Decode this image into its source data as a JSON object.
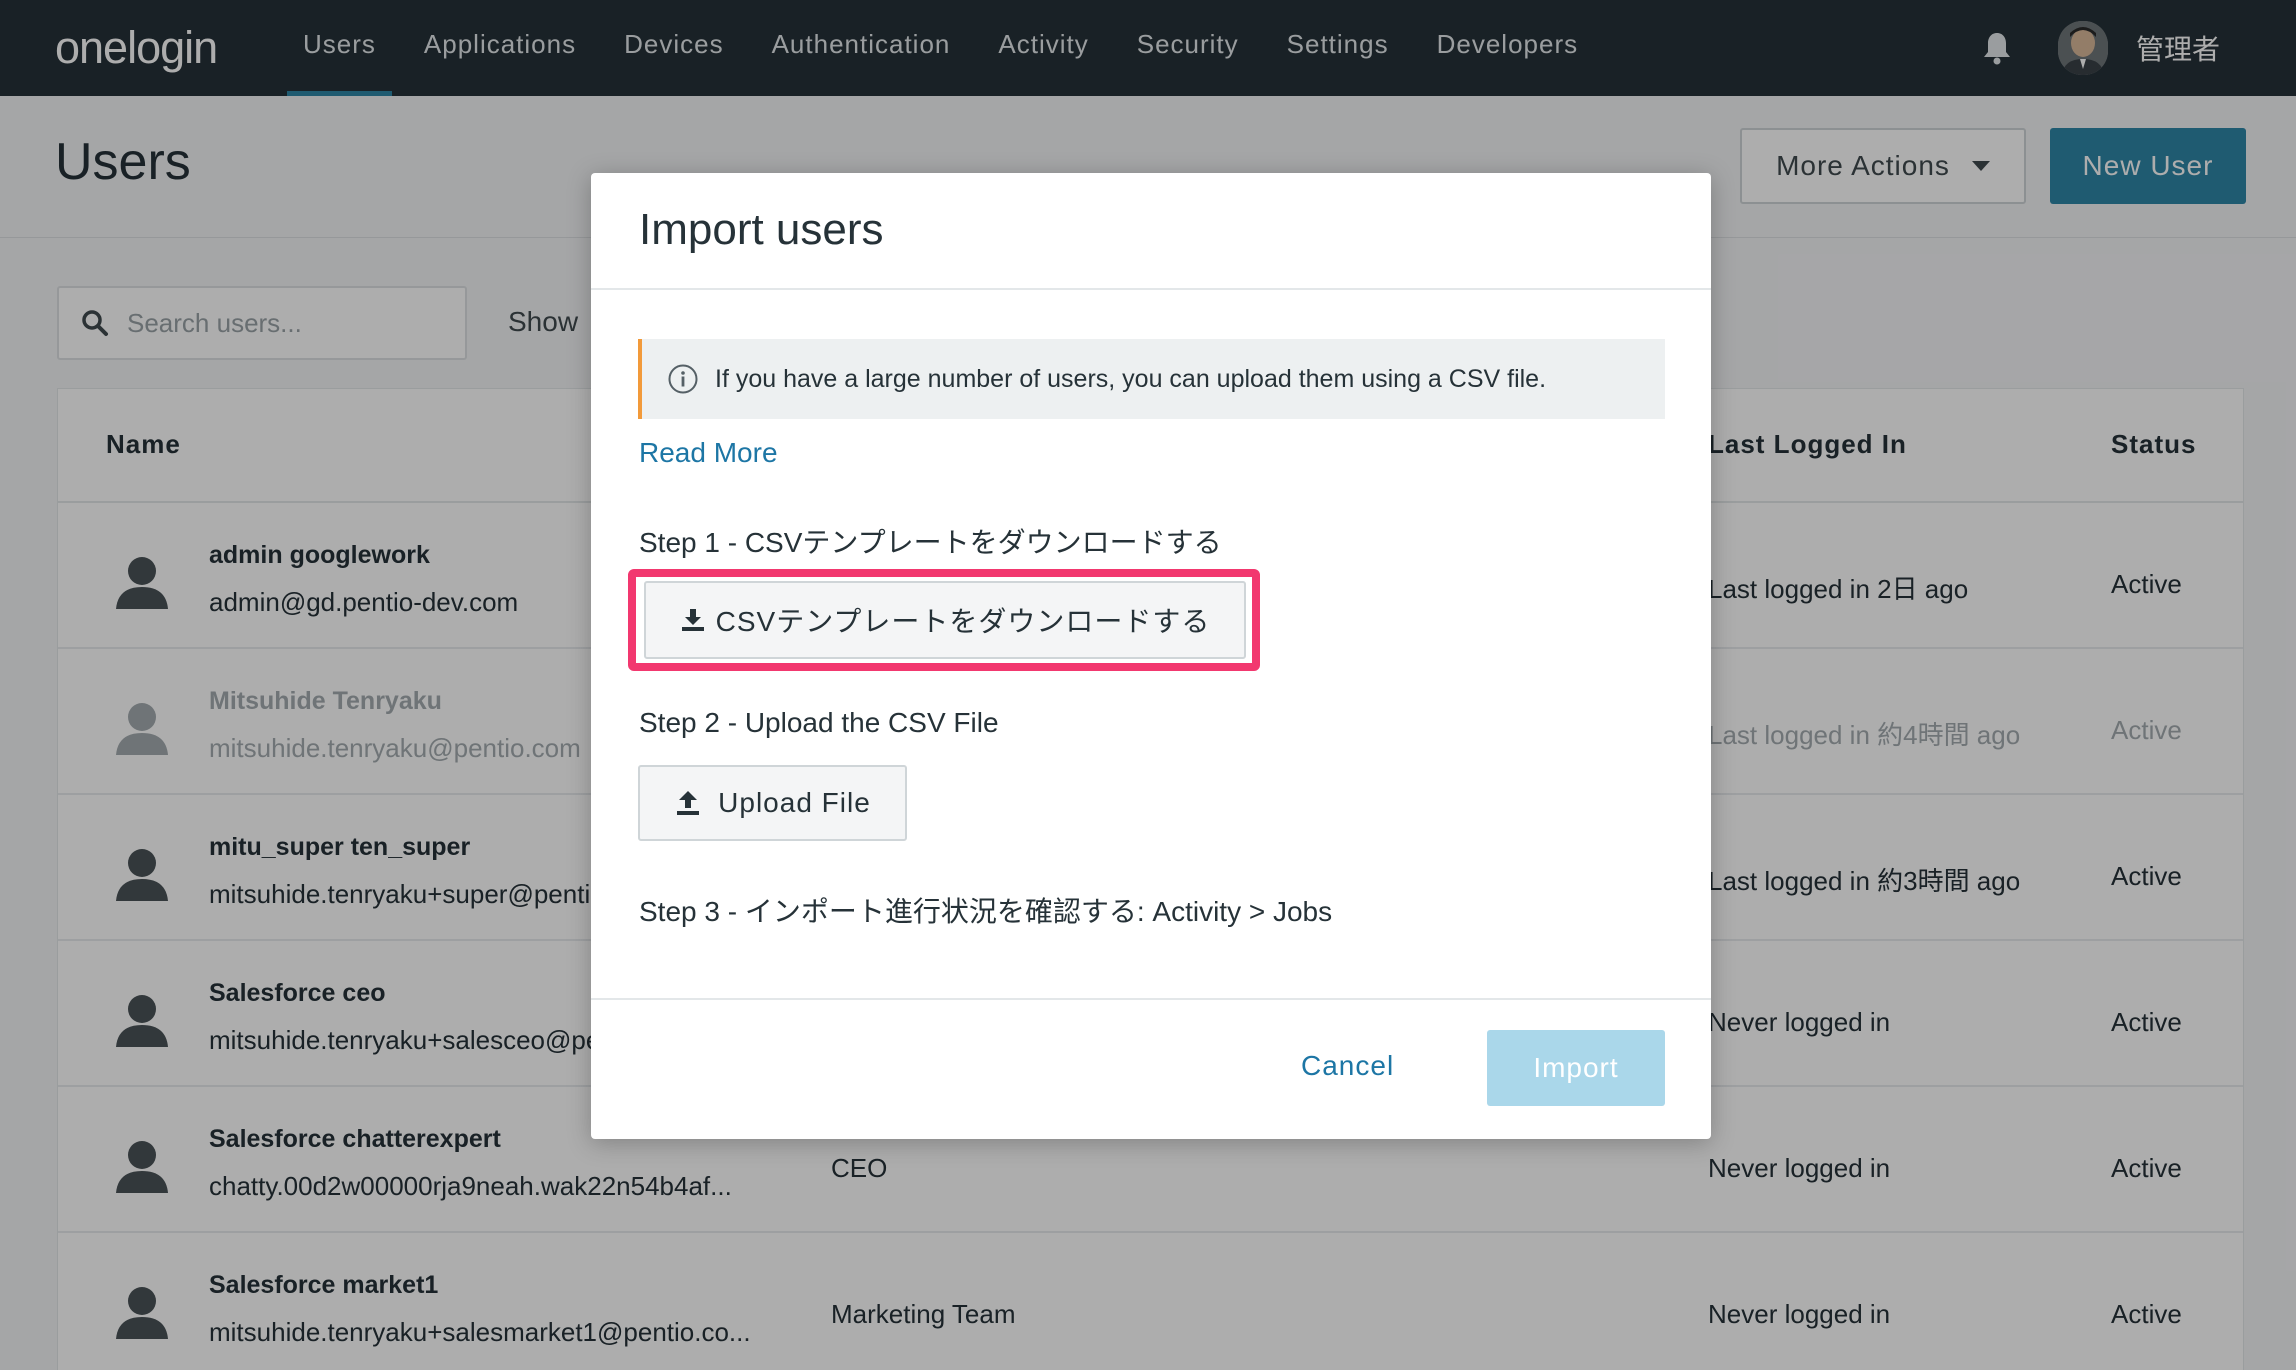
{
  "nav": {
    "logo": "onelogin",
    "items": [
      "Users",
      "Applications",
      "Devices",
      "Authentication",
      "Activity",
      "Security",
      "Settings",
      "Developers"
    ],
    "active_index": 0,
    "admin_name": "管理者"
  },
  "header": {
    "title": "Users",
    "more_actions": "More Actions",
    "new_user": "New User"
  },
  "filters": {
    "search_placeholder": "Search users...",
    "show_label": "Show"
  },
  "table": {
    "columns": {
      "name": "Name",
      "last_logged_in": "Last Logged In",
      "status": "Status"
    },
    "rows": [
      {
        "name": "admin googlework",
        "email": "admin@gd.pentio-dev.com",
        "title": "",
        "last": "Last logged in 2日 ago",
        "status": "Active",
        "dim": false
      },
      {
        "name": "Mitsuhide Tenryaku",
        "email": "mitsuhide.tenryaku@pentio.com",
        "title": "",
        "last": "Last logged in 約4時間 ago",
        "status": "Active",
        "dim": true
      },
      {
        "name": "mitu_super ten_super",
        "email": "mitsuhide.tenryaku+super@pentio.com",
        "title": "",
        "last": "Last logged in 約3時間 ago",
        "status": "Active",
        "dim": false
      },
      {
        "name": "Salesforce ceo",
        "email": "mitsuhide.tenryaku+salesceo@pentio.com",
        "title": "",
        "last": "Never logged in",
        "status": "Active",
        "dim": false
      },
      {
        "name": "Salesforce chatterexpert",
        "email": "chatty.00d2w00000rja9neah.wak22n54b4af...",
        "title": "CEO",
        "last": "Never logged in",
        "status": "Active",
        "dim": false
      },
      {
        "name": "Salesforce market1",
        "email": "mitsuhide.tenryaku+salesmarket1@pentio.co...",
        "title": "Marketing Team",
        "last": "Never logged in",
        "status": "Active",
        "dim": false
      }
    ]
  },
  "modal": {
    "title": "Import users",
    "info": "If you have a large number of users, you can upload them using a CSV file.",
    "read_more": "Read More",
    "step1": "Step 1 - CSVテンプレートをダウンロードする",
    "download_button": "CSVテンプレートをダウンロードする",
    "step2": "Step 2 - Upload the CSV File",
    "upload_button": "Upload File",
    "step3": "Step 3 - インポート進行状況を確認する: Activity > Jobs",
    "cancel": "Cancel",
    "import": "Import"
  },
  "colors": {
    "nav_bg": "#263238",
    "accent": "#2f86a7",
    "link": "#1d76a5",
    "highlight": "#f2386f",
    "info_bar": "#f29a3a",
    "import_disabled": "#aad7ea"
  }
}
